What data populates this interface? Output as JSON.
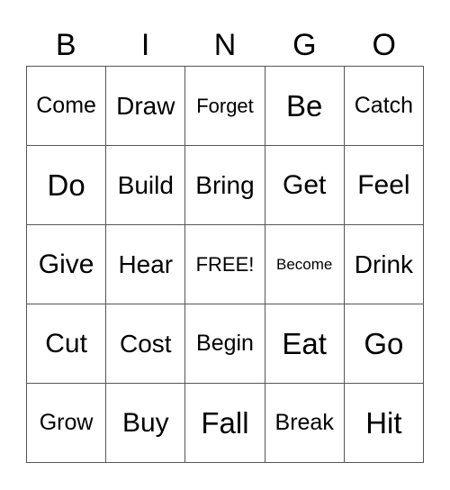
{
  "header": [
    "B",
    "I",
    "N",
    "G",
    "O"
  ],
  "cells": [
    [
      "Come",
      "Draw",
      "Forget",
      "Be",
      "Catch"
    ],
    [
      "Do",
      "Build",
      "Bring",
      "Get",
      "Feel"
    ],
    [
      "Give",
      "Hear",
      "FREE!",
      "Become",
      "Drink"
    ],
    [
      "Cut",
      "Cost",
      "Begin",
      "Eat",
      "Go"
    ],
    [
      "Grow",
      "Buy",
      "Fall",
      "Break",
      "Hit"
    ]
  ]
}
